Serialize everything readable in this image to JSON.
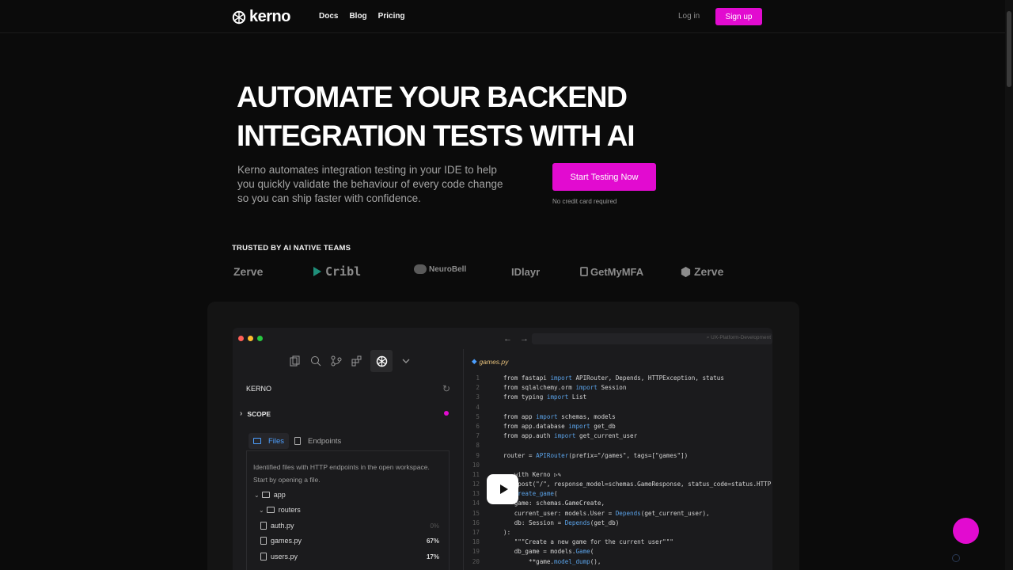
{
  "nav": {
    "logo_text": "kerno",
    "links": [
      "Docs",
      "Blog",
      "Pricing"
    ],
    "login": "Log in",
    "signup": "Sign up"
  },
  "hero": {
    "title_line1": "AUTOMATE YOUR BACKEND",
    "title_line2": "INTEGRATION TESTS WITH AI",
    "subtitle": "Kerno automates integration testing in your IDE to help you quickly validate the behaviour of every code change so you can ship faster with confidence.",
    "cta": "Start Testing Now",
    "cta_note": "No credit card required"
  },
  "trusted": {
    "heading": "TRUSTED BY AI NATIVE TEAMS",
    "brands": [
      "Zerve",
      "Cribl",
      "NeuroBell",
      "IDlayr",
      "GetMyMFA",
      "Zerve"
    ]
  },
  "demo": {
    "window_dot_colors": [
      "#ff5f57",
      "#febc2e",
      "#28c840"
    ],
    "search_placeholder": "UX-Platform-Development",
    "sidebar": {
      "title": "KERNO",
      "scope": "SCOPE",
      "tabs": [
        "Files",
        "Endpoints"
      ],
      "description": "Identified files with HTTP endpoints in the open workspace. Start by opening a file.",
      "tree": [
        {
          "name": "app",
          "type": "folder",
          "indent": 0
        },
        {
          "name": "routers",
          "type": "folder",
          "indent": 1
        },
        {
          "name": "auth.py",
          "type": "file",
          "indent": 2,
          "pct": "0%"
        },
        {
          "name": "games.py",
          "type": "file",
          "indent": 2,
          "pct": "67%"
        },
        {
          "name": "users.py",
          "type": "file",
          "indent": 2,
          "pct": "17%"
        }
      ]
    },
    "editor": {
      "filename": "games.py",
      "lines": [
        {
          "n": "1",
          "t": [
            [
              "ct",
              "from fastapi "
            ],
            [
              "kw",
              "import"
            ],
            [
              "ct",
              " APIRouter, Depends, HTTPException, status"
            ]
          ]
        },
        {
          "n": "2",
          "t": [
            [
              "ct",
              "from sqlalchemy.orm "
            ],
            [
              "kw",
              "import"
            ],
            [
              "ct",
              " Session"
            ]
          ]
        },
        {
          "n": "3",
          "t": [
            [
              "ct",
              "from typing "
            ],
            [
              "kw",
              "import"
            ],
            [
              "ct",
              " List"
            ]
          ]
        },
        {
          "n": "4",
          "t": []
        },
        {
          "n": "5",
          "t": [
            [
              "ct",
              "from app "
            ],
            [
              "kw",
              "import"
            ],
            [
              "ct",
              " schemas, models"
            ]
          ]
        },
        {
          "n": "6",
          "t": [
            [
              "ct",
              "from app.database "
            ],
            [
              "kw",
              "import"
            ],
            [
              "ct",
              " get_db"
            ]
          ]
        },
        {
          "n": "7",
          "t": [
            [
              "ct",
              "from app.auth "
            ],
            [
              "kw",
              "import"
            ],
            [
              "ct",
              " get_current_user"
            ]
          ]
        },
        {
          "n": "8",
          "t": []
        },
        {
          "n": "9",
          "t": [
            [
              "ct",
              "router = "
            ],
            [
              "kw",
              "APIRouter"
            ],
            [
              "ct",
              "(prefix="
            ],
            [
              "str",
              "\"/games\""
            ],
            [
              "ct",
              ", tags=["
            ],
            [
              "str",
              "\"games\""
            ],
            [
              "ct",
              "])"
            ]
          ]
        },
        {
          "n": "10",
          "t": []
        },
        {
          "n": "11",
          "t": [
            [
              "ct",
              "   with Kerno ▷✎"
            ]
          ]
        },
        {
          "n": "12",
          "t": [
            [
              "ct",
              "ter.post("
            ],
            [
              "str",
              "\"/\""
            ],
            [
              "ct",
              ", response_model=schemas.GameResponse, status_code=status.HTTP"
            ]
          ]
        },
        {
          "n": "13",
          "t": [
            [
              "kw",
              "   create_game"
            ],
            [
              "ct",
              "("
            ]
          ]
        },
        {
          "n": "14",
          "t": [
            [
              "ct",
              "   game: schemas.GameCreate,"
            ]
          ]
        },
        {
          "n": "15",
          "t": [
            [
              "ct",
              "   current_user: models.User = "
            ],
            [
              "kw",
              "Depends"
            ],
            [
              "ct",
              "(get_current_user),"
            ]
          ]
        },
        {
          "n": "16",
          "t": [
            [
              "ct",
              "   db: Session = "
            ],
            [
              "kw",
              "Depends"
            ],
            [
              "ct",
              "(get_db)"
            ]
          ]
        },
        {
          "n": "17",
          "t": [
            [
              "ct",
              "):"
            ]
          ]
        },
        {
          "n": "18",
          "t": [
            [
              "ct",
              "   "
            ],
            [
              "str",
              "\"\"\"Create a new game for the current user\"\"\""
            ]
          ]
        },
        {
          "n": "19",
          "t": [
            [
              "ct",
              "   db_game = models."
            ],
            [
              "kw",
              "Game"
            ],
            [
              "ct",
              "("
            ]
          ]
        },
        {
          "n": "20",
          "t": [
            [
              "ct",
              "       **game."
            ],
            [
              "kw",
              "model_dump"
            ],
            [
              "ct",
              "(),"
            ]
          ]
        }
      ]
    }
  }
}
